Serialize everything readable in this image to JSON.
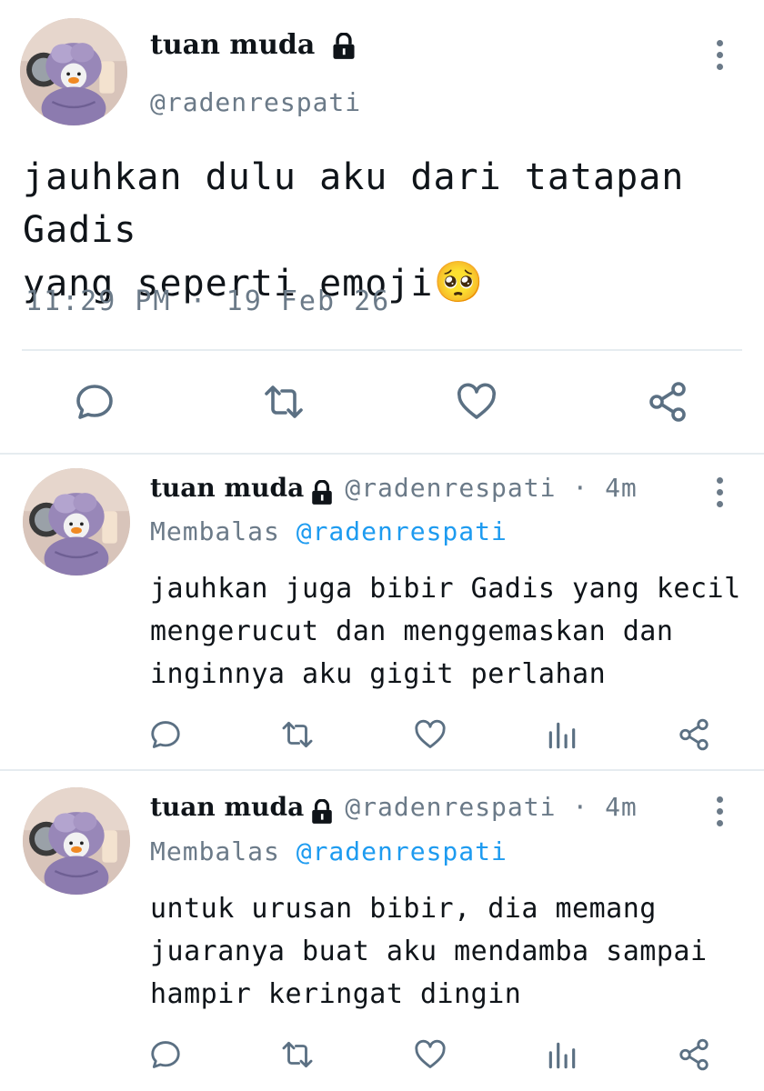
{
  "main_tweet": {
    "display_name": "tuan muda",
    "handle": "@radenrespati",
    "text_line1": "jauhkan dulu aku dari tatapan Gadis",
    "text_line2": "yang seperti emoji",
    "emoji": "🥺",
    "time": "11:29 PM · 19 Feb 26"
  },
  "replies": [
    {
      "display_name": "tuan muda",
      "handle": "@radenrespati · 4m",
      "reply_prefix": "Membalas",
      "reply_to": "@radenrespati",
      "lines": [
        "jauhkan juga bibir Gadis yang kecil",
        "mengerucut dan menggemaskan dan",
        "inginnya aku gigit perlahan"
      ]
    },
    {
      "display_name": "tuan muda",
      "handle": "@radenrespati · 4m",
      "reply_prefix": "Membalas",
      "reply_to": "@radenrespati",
      "lines": [
        "untuk urusan bibir, dia memang",
        "juaranya buat aku mendamba sampai",
        "hampir keringat dingin"
      ]
    }
  ],
  "icons": [
    "reply-icon",
    "retweet-icon",
    "like-icon",
    "share-icon",
    "stats-icon",
    "lock-icon",
    "more-icon"
  ],
  "colors": {
    "text": "#0f1419",
    "muted": "#6b7a88",
    "link": "#1d9bf0",
    "divider": "#e6ecf0"
  }
}
